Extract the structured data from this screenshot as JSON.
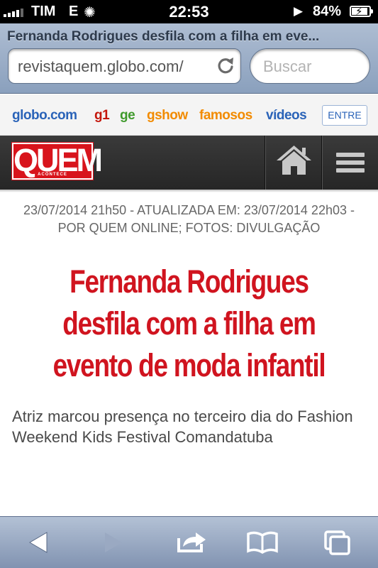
{
  "status_bar": {
    "carrier": "TIM",
    "network": "E",
    "time": "22:53",
    "battery_percent": "84%",
    "battery_level": 0.84
  },
  "browser": {
    "page_title": "Fernanda Rodrigues desfila com a filha em eve...",
    "url": "revistaquem.globo.com/",
    "search_placeholder": "Buscar"
  },
  "globo_nav": {
    "links": [
      {
        "label": "globo.com",
        "color": "#2a63b8"
      },
      {
        "label": "g1",
        "color": "#c4170c"
      },
      {
        "label": "ge",
        "color": "#3f9a2c"
      },
      {
        "label": "gshow",
        "color": "#f28b00"
      },
      {
        "label": "famosos",
        "color": "#f28b00"
      },
      {
        "label": "vídeos",
        "color": "#2a63b8"
      }
    ],
    "login_label": "ENTRE"
  },
  "site_header": {
    "logo_text": "QUEM",
    "logo_subtext": "ACONTECE",
    "brand_color": "#d8141c",
    "home_icon": "home-icon",
    "menu_icon": "hamburger-icon"
  },
  "article": {
    "meta_line1": "23/07/2014 21h50 - ATUALIZADA EM: 23/07/2014 22h03 -",
    "meta_line2": "POR QUEM ONLINE; FOTOS: DIVULGAÇÃO",
    "headline": "Fernanda Rodrigues desfila com a filha em evento de moda infantil",
    "subtitle": "Atriz marcou presença no terceiro dia do Fashion Weekend Kids Festival Comandatuba",
    "headline_color": "#d0141f"
  },
  "toolbar": {
    "buttons": [
      "back-icon",
      "forward-icon",
      "share-icon",
      "bookmarks-icon",
      "tabs-icon"
    ]
  }
}
